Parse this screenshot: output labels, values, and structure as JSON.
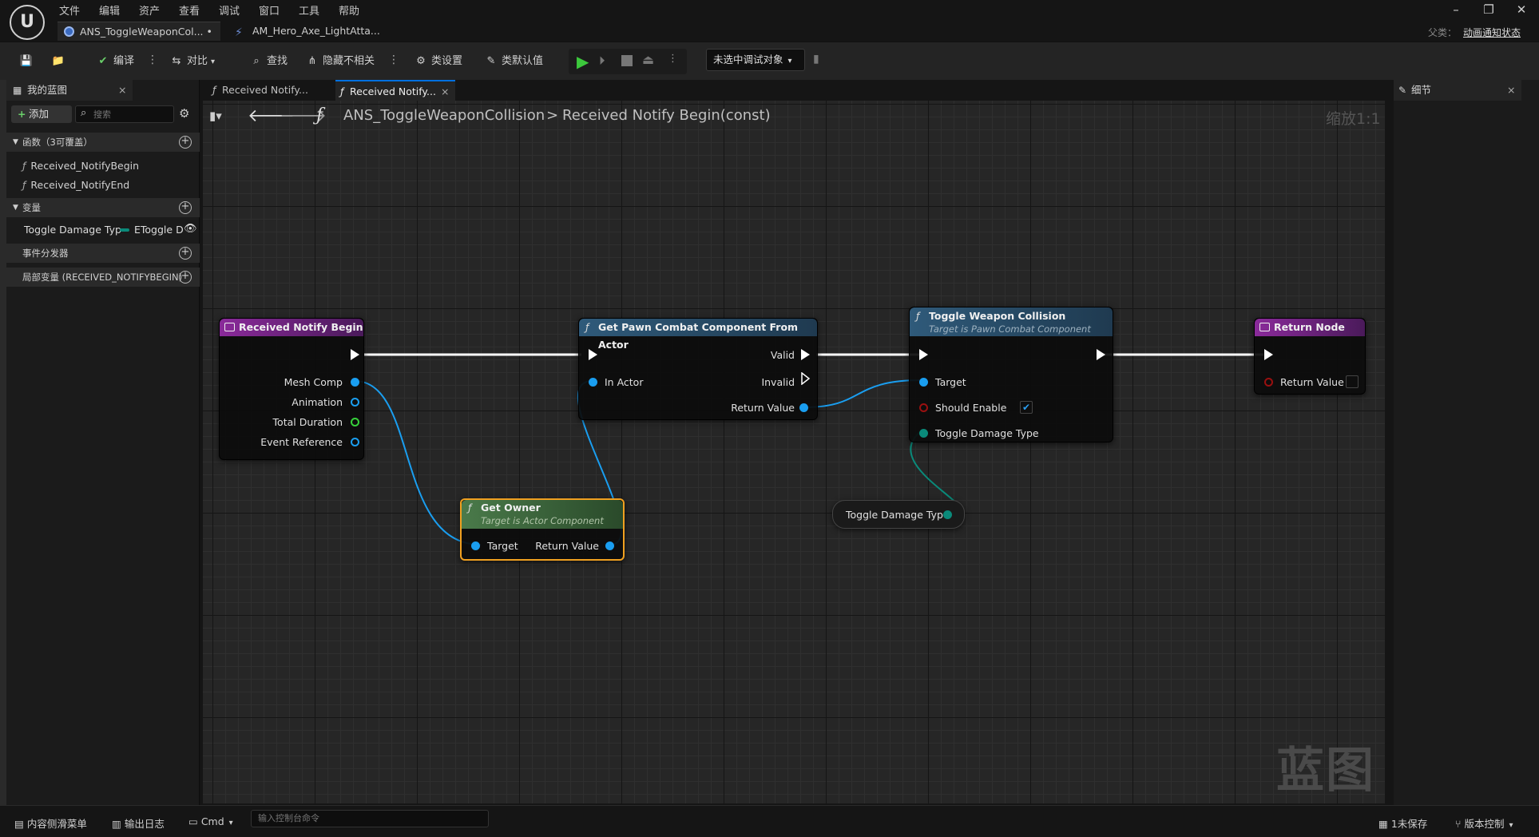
{
  "app": {
    "logo_text": "U",
    "menu": [
      "文件",
      "编辑",
      "资产",
      "查看",
      "调试",
      "窗口",
      "工具",
      "帮助"
    ],
    "doc_tabs": [
      {
        "label": "ANS_ToggleWeaponCol... •",
        "close": "×"
      },
      {
        "label": "AM_Hero_Axe_LightAtta..."
      }
    ],
    "parent_label": "父类：",
    "parent_value": "动画通知状态"
  },
  "toolbar": {
    "compile": "编译",
    "diff": "对比",
    "find": "查找",
    "hide_unrelated": "隐藏不相关",
    "class_settings": "类设置",
    "class_defaults": "类默认值",
    "debug_object": "未选中调试对象"
  },
  "my_blueprint": {
    "tab_label": "我的蓝图",
    "add_label": "添加",
    "search_placeholder": "搜索",
    "functions_header": "函数（3可覆盖）",
    "functions": [
      "Received_NotifyBegin",
      "Received_NotifyEnd"
    ],
    "variables_header": "变量",
    "variable_name": "Toggle Damage Typ",
    "variable_type": "EToggle D",
    "dispatchers_header": "事件分发器",
    "locals_header": "局部变量 (RECEIVED_NOTIFYBEGIN)"
  },
  "graph_tabs": [
    "Received Notify...",
    "Received Notify..."
  ],
  "breadcrumb": {
    "root": "ANS_ToggleWeaponCollision",
    "separator": ">",
    "current": "Received Notify Begin(const)"
  },
  "zoom_label": "缩放1:1",
  "watermark": "蓝图",
  "details": {
    "tab_label": "细节"
  },
  "nodes": {
    "notify_begin": {
      "title": "Received Notify Begin",
      "pins": [
        "Mesh Comp",
        "Animation",
        "Total Duration",
        "Event Reference"
      ]
    },
    "get_pawn_combat": {
      "title": "Get Pawn Combat Component From Actor",
      "in_actor": "In Actor",
      "valid": "Valid",
      "invalid": "Invalid",
      "return_value": "Return Value"
    },
    "toggle_weapon": {
      "title": "Toggle Weapon Collision",
      "subtitle": "Target is Pawn Combat Component",
      "target": "Target",
      "should_enable": "Should Enable",
      "toggle_type": "Toggle Damage Type"
    },
    "return_node": {
      "title": "Return Node",
      "return_value": "Return Value"
    },
    "get_owner": {
      "title": "Get Owner",
      "subtitle": "Target is Actor Component",
      "target": "Target",
      "return_value": "Return Value"
    },
    "var_getter": {
      "label": "Toggle Damage Type"
    }
  },
  "bottom": {
    "content_drawer": "内容侧滑菜单",
    "output_log": "输出日志",
    "cmd": "Cmd",
    "console_placeholder": "输入控制台命令",
    "unsaved": "1未保存",
    "source_control": "版本控制"
  },
  "colors": {
    "accent_blue": "#0070e0",
    "object_pin": "#1a9ef0",
    "float_pin": "#36d13a",
    "enum_pin": "#0a8a7a",
    "bool_pin": "#9a1010",
    "event_header": "#7a2a8a",
    "function_header": "#2c4e6a",
    "pure_header": "#3c6a3c",
    "selection": "#f0a020"
  }
}
